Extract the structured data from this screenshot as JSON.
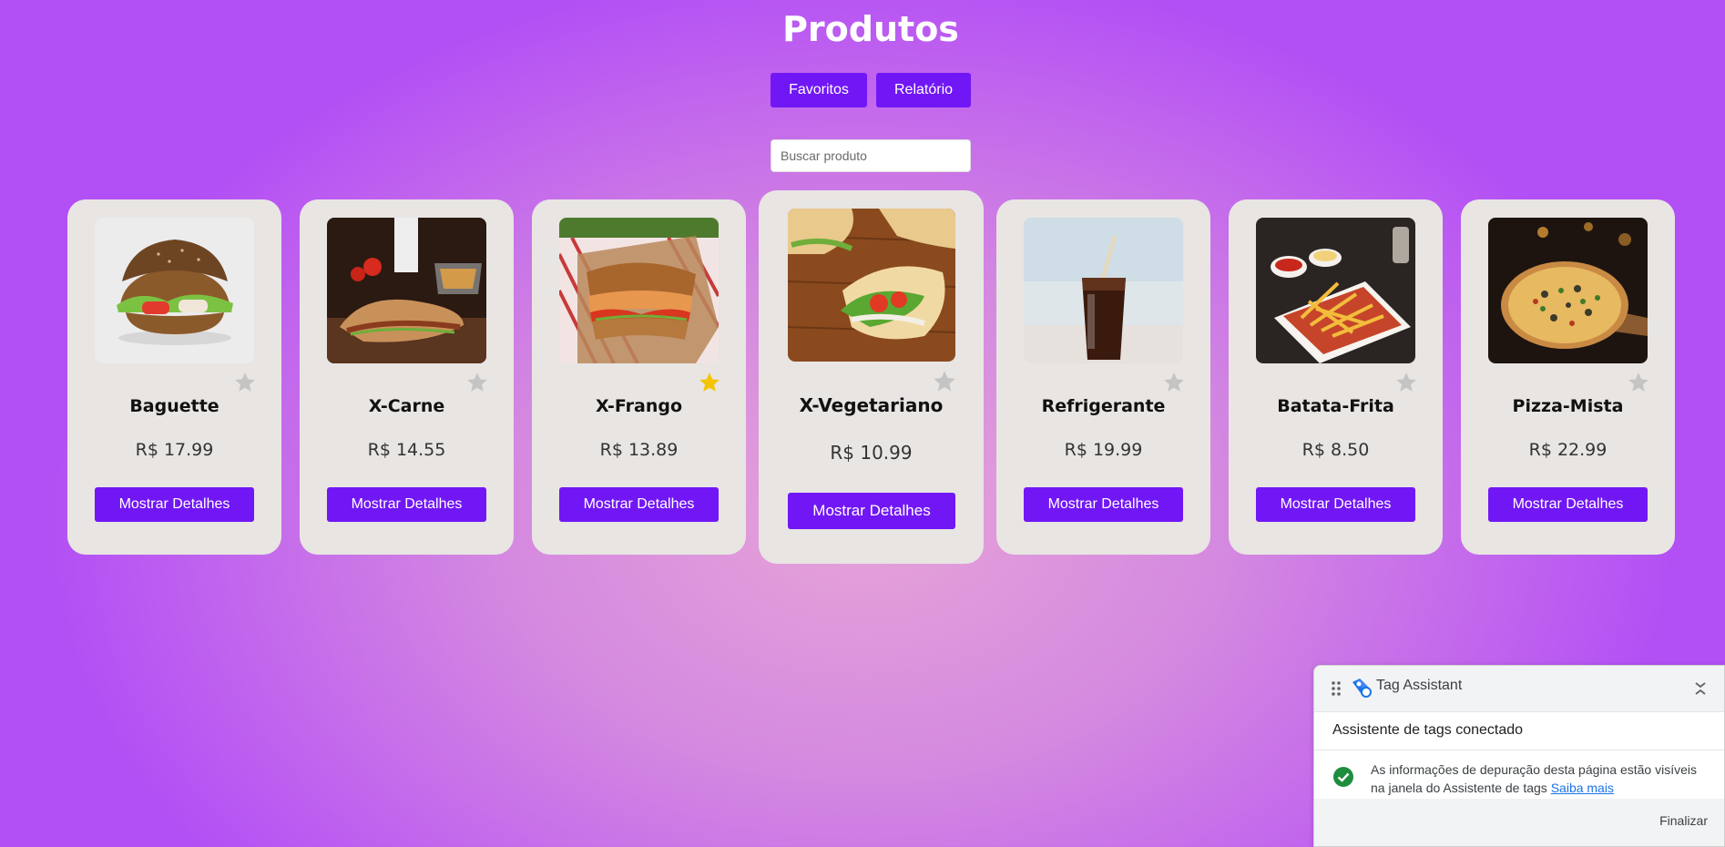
{
  "header": {
    "title": "Produtos",
    "favorites_label": "Favoritos",
    "report_label": "Relatório"
  },
  "search": {
    "placeholder": "Buscar produto",
    "value": ""
  },
  "products": [
    {
      "name": "Baguette",
      "price": "R$ 17.99",
      "favorite": false,
      "image": "sandwich-burger-bun",
      "button_label": "Mostrar Detalhes"
    },
    {
      "name": "X-Carne",
      "price": "R$ 14.55",
      "favorite": false,
      "image": "meat-sandwich",
      "button_label": "Mostrar Detalhes"
    },
    {
      "name": "X-Frango",
      "price": "R$ 13.89",
      "favorite": true,
      "image": "chicken-sandwich",
      "button_label": "Mostrar Detalhes"
    },
    {
      "name": "X-Vegetariano",
      "price": "R$ 10.99",
      "favorite": false,
      "image": "veggie-sandwich",
      "button_label": "Mostrar Detalhes",
      "hovered": true
    },
    {
      "name": "Refrigerante",
      "price": "R$ 19.99",
      "favorite": false,
      "image": "soda-glass",
      "button_label": "Mostrar Detalhes"
    },
    {
      "name": "Batata-Frita",
      "price": "R$ 8.50",
      "favorite": false,
      "image": "french-fries",
      "button_label": "Mostrar Detalhes"
    },
    {
      "name": "Pizza-Mista",
      "price": "R$ 22.99",
      "favorite": false,
      "image": "pizza",
      "button_label": "Mostrar Detalhes"
    }
  ],
  "tag_assistant": {
    "title": "Tag Assistant",
    "status": "Assistente de tags conectado",
    "info_text": "As informações de depuração desta página estão visíveis na janela do Assistente de tags",
    "link_label": "Saiba mais",
    "finish_label": "Finalizar"
  },
  "colors": {
    "accent": "#7117f5",
    "card_bg": "#e8e5e3",
    "star_active": "#f5c400",
    "star_inactive": "#c4c4c4",
    "check_green": "#1e8e3e"
  }
}
